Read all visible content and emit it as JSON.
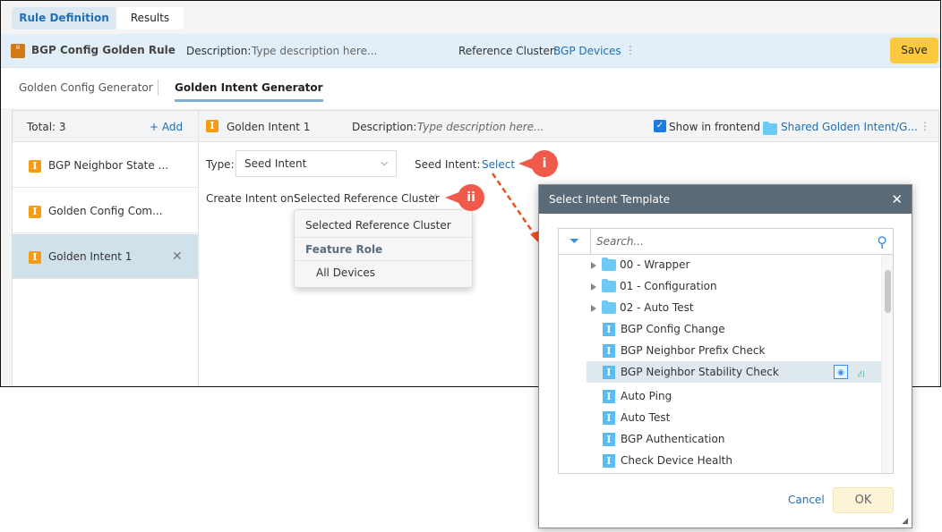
{
  "tabs": [
    "Rule Definition",
    "Results"
  ],
  "rule": {
    "title": "BGP Config Golden Rule",
    "desc_label": "Description:",
    "desc_placeholder": "Type description here...",
    "ref_label": "Reference Cluster:",
    "ref_value": "BGP Devices",
    "save": "Save"
  },
  "subtabs": [
    "Golden Config Generator",
    "Golden Intent Generator"
  ],
  "list": {
    "total": "Total: 3",
    "add": "+ Add",
    "items": [
      "BGP Neighbor State ...",
      "Golden Config Com...",
      "Golden Intent 1"
    ]
  },
  "detail": {
    "name": "Golden Intent 1",
    "desc_label": "Description:",
    "desc_placeholder": "Type description here...",
    "show_frontend": "Show in frontend",
    "show_frontend_checked": true,
    "folder": "Shared Golden Intent/G...",
    "type_label": "Type:",
    "type_value": "Seed Intent",
    "seed_label": "Seed Intent:",
    "seed_link": "Select",
    "create_label": "Create Intent on:",
    "create_value": "Selected Reference Cluster"
  },
  "menu": {
    "items": [
      "Selected Reference Cluster",
      "Feature Role",
      "All Devices"
    ]
  },
  "markers": [
    "i",
    "ii"
  ],
  "dialog": {
    "title": "Select Intent Template",
    "search_placeholder": "Search...",
    "folders": [
      "00 - Wrapper",
      "01 - Configuration",
      "02 - Auto Test"
    ],
    "items": [
      "BGP Config Change",
      "BGP Neighbor Prefix Check",
      "BGP Neighbor Stability Check",
      "Auto Ping",
      "Auto Test",
      "BGP Authentication",
      "Check Device Health"
    ],
    "selected": "BGP Neighbor Stability Check",
    "cancel": "Cancel",
    "ok": "OK"
  }
}
